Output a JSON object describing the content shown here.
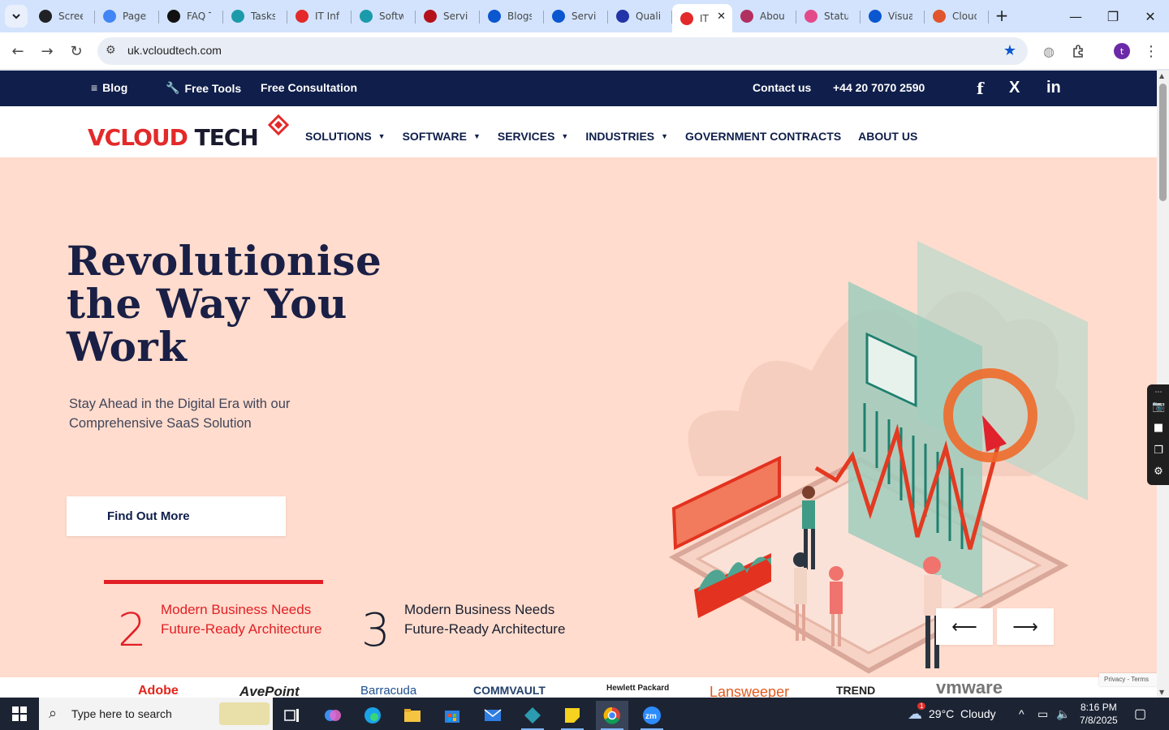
{
  "browser": {
    "tabs": [
      {
        "title": "Screen",
        "icon": "screen-recorder-icon",
        "color": "#202124"
      },
      {
        "title": "PageS",
        "icon": "pagespeed-icon",
        "color": "#4285f4"
      },
      {
        "title": "FAQ T",
        "icon": "faq-icon",
        "color": "#111111"
      },
      {
        "title": "Tasks",
        "icon": "tasks-icon",
        "color": "#1b9aaa"
      },
      {
        "title": "IT Infr",
        "icon": "vcloud-icon",
        "color": "#e32929"
      },
      {
        "title": "Softw",
        "icon": "software-icon",
        "color": "#1b9aaa"
      },
      {
        "title": "Servic",
        "icon": "v-icon",
        "color": "#b3121b"
      },
      {
        "title": "Blogs",
        "icon": "scales-icon",
        "color": "#0b57d0"
      },
      {
        "title": "Servic",
        "icon": "check-icon",
        "color": "#0b57d0"
      },
      {
        "title": "Qualit",
        "icon": "x-logo-icon",
        "color": "#2334a8"
      },
      {
        "title": "IT",
        "icon": "vcloud-icon",
        "color": "#e32929",
        "active": true
      },
      {
        "title": "About",
        "icon": "about-icon",
        "color": "#b03060"
      },
      {
        "title": "Status",
        "icon": "status-icon",
        "color": "#e24a8a"
      },
      {
        "title": "Visual",
        "icon": "pulse-icon",
        "color": "#0b57d0"
      },
      {
        "title": "Cloud",
        "icon": "cloud-slash-icon",
        "color": "#e0552d"
      }
    ],
    "url": "uk.vcloudtech.com",
    "profile_initial": "t"
  },
  "site": {
    "topbar": {
      "blog": "Blog",
      "free_tools": "Free Tools",
      "free_consultation": "Free Consultation",
      "contact": "Contact us",
      "phone": "+44 20 7070 2590",
      "social": [
        "f",
        "X",
        "in"
      ]
    },
    "logo": {
      "v": "V",
      "cloud": "CLOUD",
      "tech": " TECH"
    },
    "nav": [
      {
        "label": "SOLUTIONS",
        "dropdown": true
      },
      {
        "label": "SOFTWARE",
        "dropdown": true
      },
      {
        "label": "SERVICES",
        "dropdown": true
      },
      {
        "label": "INDUSTRIES",
        "dropdown": true
      },
      {
        "label": "GOVERNMENT CONTRACTS",
        "dropdown": false
      },
      {
        "label": "ABOUT US",
        "dropdown": false
      }
    ],
    "hero": {
      "title": "Revolutionise the Way You Work",
      "subtitle": "Stay Ahead in the Digital Era with our Comprehensive SaaS Solution",
      "cta": "Find Out More"
    },
    "features": [
      {
        "num": "2",
        "text": "Modern Business Needs Future-Ready Architecture"
      },
      {
        "num": "3",
        "text": "Modern Business Needs Future-Ready Architecture"
      }
    ],
    "arrows": {
      "prev": "⟵",
      "next": "⟶"
    },
    "brands": [
      "Adobe",
      "AvePoint",
      "Barracuda",
      "COMMVAULT",
      "Hewlett Packard",
      "Lansweeper",
      "TREND",
      "vmware"
    ],
    "recaptcha": "Privacy - Terms"
  },
  "taskbar": {
    "search_placeholder": "Type here to search",
    "weather": "29°C  Cloudy",
    "time": "8:16 PM",
    "date": "7/8/2025",
    "weather_badge": "1"
  },
  "colors": {
    "accent": "#e21f26",
    "navy": "#0f1e4a",
    "hero_bg": "#ffdccd"
  }
}
